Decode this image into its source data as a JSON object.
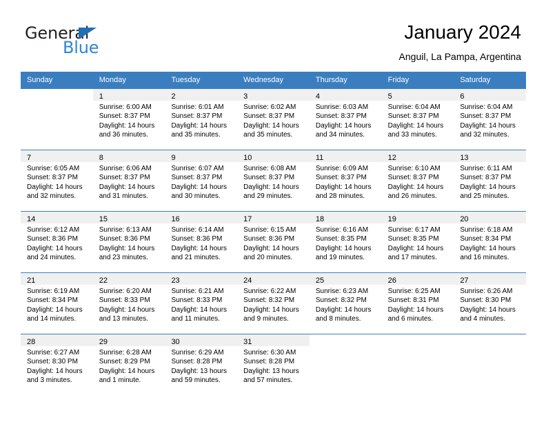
{
  "brand": {
    "name_part1": "General",
    "name_part2": "Blue"
  },
  "header": {
    "title": "January 2024",
    "subtitle": "Anguil, La Pampa, Argentina"
  },
  "weekday_headers": [
    "Sunday",
    "Monday",
    "Tuesday",
    "Wednesday",
    "Thursday",
    "Friday",
    "Saturday"
  ],
  "colors": {
    "header_blue": "#3a7ebf",
    "daynum_band": "#f0f0f0",
    "brand_blue": "#2e86d6",
    "brand_dark": "#231f20"
  },
  "labels": {
    "sunrise_prefix": "Sunrise: ",
    "sunset_prefix": "Sunset: ",
    "daylight_prefix": "Daylight: "
  },
  "weeks": [
    [
      {
        "day": ""
      },
      {
        "day": "1",
        "sunrise": "Sunrise: 6:00 AM",
        "sunset": "Sunset: 8:37 PM",
        "daylight_l1": "Daylight: 14 hours",
        "daylight_l2": "and 36 minutes."
      },
      {
        "day": "2",
        "sunrise": "Sunrise: 6:01 AM",
        "sunset": "Sunset: 8:37 PM",
        "daylight_l1": "Daylight: 14 hours",
        "daylight_l2": "and 35 minutes."
      },
      {
        "day": "3",
        "sunrise": "Sunrise: 6:02 AM",
        "sunset": "Sunset: 8:37 PM",
        "daylight_l1": "Daylight: 14 hours",
        "daylight_l2": "and 35 minutes."
      },
      {
        "day": "4",
        "sunrise": "Sunrise: 6:03 AM",
        "sunset": "Sunset: 8:37 PM",
        "daylight_l1": "Daylight: 14 hours",
        "daylight_l2": "and 34 minutes."
      },
      {
        "day": "5",
        "sunrise": "Sunrise: 6:04 AM",
        "sunset": "Sunset: 8:37 PM",
        "daylight_l1": "Daylight: 14 hours",
        "daylight_l2": "and 33 minutes."
      },
      {
        "day": "6",
        "sunrise": "Sunrise: 6:04 AM",
        "sunset": "Sunset: 8:37 PM",
        "daylight_l1": "Daylight: 14 hours",
        "daylight_l2": "and 32 minutes."
      }
    ],
    [
      {
        "day": "7",
        "sunrise": "Sunrise: 6:05 AM",
        "sunset": "Sunset: 8:37 PM",
        "daylight_l1": "Daylight: 14 hours",
        "daylight_l2": "and 32 minutes."
      },
      {
        "day": "8",
        "sunrise": "Sunrise: 6:06 AM",
        "sunset": "Sunset: 8:37 PM",
        "daylight_l1": "Daylight: 14 hours",
        "daylight_l2": "and 31 minutes."
      },
      {
        "day": "9",
        "sunrise": "Sunrise: 6:07 AM",
        "sunset": "Sunset: 8:37 PM",
        "daylight_l1": "Daylight: 14 hours",
        "daylight_l2": "and 30 minutes."
      },
      {
        "day": "10",
        "sunrise": "Sunrise: 6:08 AM",
        "sunset": "Sunset: 8:37 PM",
        "daylight_l1": "Daylight: 14 hours",
        "daylight_l2": "and 29 minutes."
      },
      {
        "day": "11",
        "sunrise": "Sunrise: 6:09 AM",
        "sunset": "Sunset: 8:37 PM",
        "daylight_l1": "Daylight: 14 hours",
        "daylight_l2": "and 28 minutes."
      },
      {
        "day": "12",
        "sunrise": "Sunrise: 6:10 AM",
        "sunset": "Sunset: 8:37 PM",
        "daylight_l1": "Daylight: 14 hours",
        "daylight_l2": "and 26 minutes."
      },
      {
        "day": "13",
        "sunrise": "Sunrise: 6:11 AM",
        "sunset": "Sunset: 8:37 PM",
        "daylight_l1": "Daylight: 14 hours",
        "daylight_l2": "and 25 minutes."
      }
    ],
    [
      {
        "day": "14",
        "sunrise": "Sunrise: 6:12 AM",
        "sunset": "Sunset: 8:36 PM",
        "daylight_l1": "Daylight: 14 hours",
        "daylight_l2": "and 24 minutes."
      },
      {
        "day": "15",
        "sunrise": "Sunrise: 6:13 AM",
        "sunset": "Sunset: 8:36 PM",
        "daylight_l1": "Daylight: 14 hours",
        "daylight_l2": "and 23 minutes."
      },
      {
        "day": "16",
        "sunrise": "Sunrise: 6:14 AM",
        "sunset": "Sunset: 8:36 PM",
        "daylight_l1": "Daylight: 14 hours",
        "daylight_l2": "and 21 minutes."
      },
      {
        "day": "17",
        "sunrise": "Sunrise: 6:15 AM",
        "sunset": "Sunset: 8:36 PM",
        "daylight_l1": "Daylight: 14 hours",
        "daylight_l2": "and 20 minutes."
      },
      {
        "day": "18",
        "sunrise": "Sunrise: 6:16 AM",
        "sunset": "Sunset: 8:35 PM",
        "daylight_l1": "Daylight: 14 hours",
        "daylight_l2": "and 19 minutes."
      },
      {
        "day": "19",
        "sunrise": "Sunrise: 6:17 AM",
        "sunset": "Sunset: 8:35 PM",
        "daylight_l1": "Daylight: 14 hours",
        "daylight_l2": "and 17 minutes."
      },
      {
        "day": "20",
        "sunrise": "Sunrise: 6:18 AM",
        "sunset": "Sunset: 8:34 PM",
        "daylight_l1": "Daylight: 14 hours",
        "daylight_l2": "and 16 minutes."
      }
    ],
    [
      {
        "day": "21",
        "sunrise": "Sunrise: 6:19 AM",
        "sunset": "Sunset: 8:34 PM",
        "daylight_l1": "Daylight: 14 hours",
        "daylight_l2": "and 14 minutes."
      },
      {
        "day": "22",
        "sunrise": "Sunrise: 6:20 AM",
        "sunset": "Sunset: 8:33 PM",
        "daylight_l1": "Daylight: 14 hours",
        "daylight_l2": "and 13 minutes."
      },
      {
        "day": "23",
        "sunrise": "Sunrise: 6:21 AM",
        "sunset": "Sunset: 8:33 PM",
        "daylight_l1": "Daylight: 14 hours",
        "daylight_l2": "and 11 minutes."
      },
      {
        "day": "24",
        "sunrise": "Sunrise: 6:22 AM",
        "sunset": "Sunset: 8:32 PM",
        "daylight_l1": "Daylight: 14 hours",
        "daylight_l2": "and 9 minutes."
      },
      {
        "day": "25",
        "sunrise": "Sunrise: 6:23 AM",
        "sunset": "Sunset: 8:32 PM",
        "daylight_l1": "Daylight: 14 hours",
        "daylight_l2": "and 8 minutes."
      },
      {
        "day": "26",
        "sunrise": "Sunrise: 6:25 AM",
        "sunset": "Sunset: 8:31 PM",
        "daylight_l1": "Daylight: 14 hours",
        "daylight_l2": "and 6 minutes."
      },
      {
        "day": "27",
        "sunrise": "Sunrise: 6:26 AM",
        "sunset": "Sunset: 8:30 PM",
        "daylight_l1": "Daylight: 14 hours",
        "daylight_l2": "and 4 minutes."
      }
    ],
    [
      {
        "day": "28",
        "sunrise": "Sunrise: 6:27 AM",
        "sunset": "Sunset: 8:30 PM",
        "daylight_l1": "Daylight: 14 hours",
        "daylight_l2": "and 3 minutes."
      },
      {
        "day": "29",
        "sunrise": "Sunrise: 6:28 AM",
        "sunset": "Sunset: 8:29 PM",
        "daylight_l1": "Daylight: 14 hours",
        "daylight_l2": "and 1 minute."
      },
      {
        "day": "30",
        "sunrise": "Sunrise: 6:29 AM",
        "sunset": "Sunset: 8:28 PM",
        "daylight_l1": "Daylight: 13 hours",
        "daylight_l2": "and 59 minutes."
      },
      {
        "day": "31",
        "sunrise": "Sunrise: 6:30 AM",
        "sunset": "Sunset: 8:28 PM",
        "daylight_l1": "Daylight: 13 hours",
        "daylight_l2": "and 57 minutes."
      },
      {
        "day": ""
      },
      {
        "day": ""
      },
      {
        "day": ""
      }
    ]
  ]
}
